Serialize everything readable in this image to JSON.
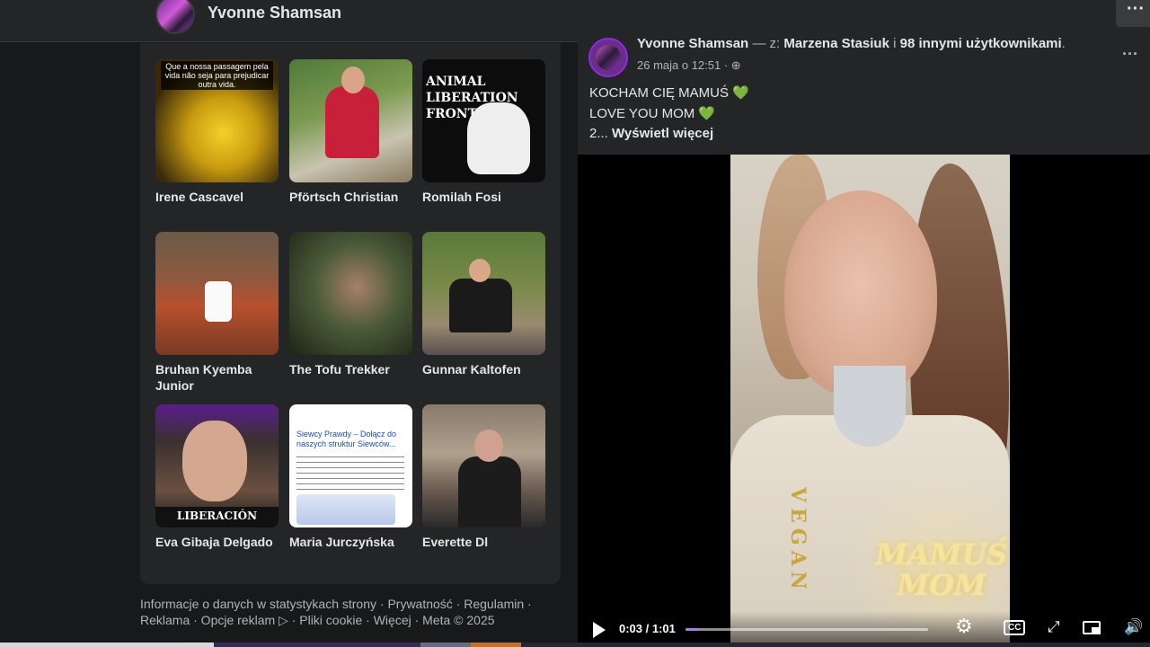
{
  "header": {
    "profile_name": "Yvonne Shamsan",
    "more_label": "···"
  },
  "friends": [
    {
      "name": "Irene Cascavel",
      "thumb_text": "Que a nossa passagem pela vida não seja para prejudicar outra vida."
    },
    {
      "name": "Pförtsch Christian"
    },
    {
      "name": "Romilah Fosi",
      "thumb_text": "ANIMAL LIBERATION FRONT"
    },
    {
      "name": "Bruhan Kyemba Junior"
    },
    {
      "name": "The Tofu Trekker"
    },
    {
      "name": "Gunnar Kaltofen"
    },
    {
      "name": "Eva Gibaja Delgado",
      "thumb_text": "LIBERACIÓN"
    },
    {
      "name": "Maria Jurczyńska",
      "thumb_text": "Siewcy Prawdy – Dołącz do naszych struktur Siewców..."
    },
    {
      "name": "Everette Dl"
    }
  ],
  "footer": {
    "line1": "Informacje o danych w statystykach strony · Prywatność · Regulamin ·",
    "line2": "Reklama · Opcje reklam ▷ · Pliki cookie · Więcej · Meta © 2025"
  },
  "post": {
    "author": "Yvonne Shamsan",
    "with_text": " — z: ",
    "tagged": "Marzena Stasiuk",
    "and_text": " i ",
    "others": "98 innymi użytkownikami",
    "date": "26 maja o 12:51 · ",
    "more_label": "···",
    "lines": [
      "KOCHAM CIĘ MAMUŚ",
      "LOVE YOU MOM",
      "2..."
    ],
    "heart": "💚",
    "see_more": "Wyświetl więcej"
  },
  "video": {
    "overlay_line1": "MAMUŚ",
    "overlay_line2": "MOM",
    "jacket_text": "VEGAN",
    "current_time": "0:03",
    "duration": "1:01",
    "time_display": "0:03 / 1:01",
    "progress_fraction": 0.05
  },
  "colors": {
    "accent": "#a57fe0",
    "heart": "#2ed52e",
    "bg": "#18191a",
    "card": "#242526"
  }
}
